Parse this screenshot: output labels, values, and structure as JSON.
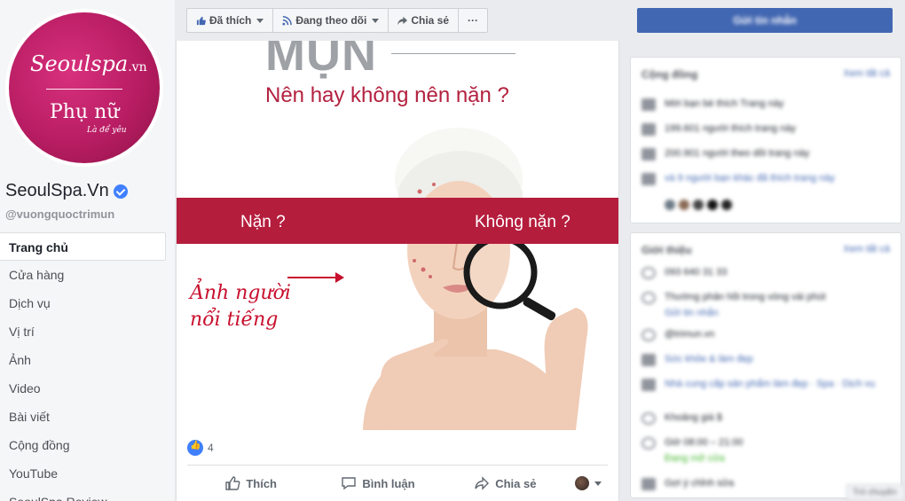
{
  "page": {
    "name": "SeoulSpa.Vn",
    "handle": "@vuongquoctrimun",
    "logo": {
      "top": "Seoulspa",
      "top_suffix": ".vn",
      "bottom": "Phụ nữ",
      "sub": "Là để yêu"
    }
  },
  "nav": {
    "items": [
      {
        "label": "Trang chủ",
        "active": true
      },
      {
        "label": "Cửa hàng"
      },
      {
        "label": "Dịch vụ"
      },
      {
        "label": "Vị trí"
      },
      {
        "label": "Ảnh"
      },
      {
        "label": "Video"
      },
      {
        "label": "Bài viết"
      },
      {
        "label": "Cộng đồng"
      },
      {
        "label": "YouTube"
      },
      {
        "label": "SeoulSpa Review"
      }
    ]
  },
  "action_bar": {
    "liked": "Đã thích",
    "following": "Đang theo dõi",
    "share": "Chia sẻ",
    "more": "···"
  },
  "post": {
    "image": {
      "big_word": "MỤN",
      "headline": "Nên hay không nên nặn ?",
      "left_choice": "Nặn ?",
      "right_choice": "Không nặn ?",
      "caption_line1": "Ảnh người",
      "caption_line2": "nổi tiếng"
    },
    "reaction_count": "4",
    "actions": {
      "like": "Thích",
      "comment": "Bình luận",
      "share": "Chia sẻ"
    }
  },
  "sidebar": {
    "contact_button": "Gửi tin nhắn",
    "community": {
      "title": "Cộng đồng",
      "link": "Xem tất cả",
      "rows": [
        "Mời bạn bè thích Trang này",
        "199.601 người thích trang này",
        "200.901 người theo dõi trang này",
        "và 9 người bạn khác đã thích trang này"
      ]
    },
    "about": {
      "title": "Giới thiệu",
      "link": "Xem tất cả",
      "rows": [
        "093 640 31 33",
        "Thường phản hồi trong vòng vài phút",
        "Gửi tin nhắn",
        "@trimun.vn",
        "Sức khỏe & làm đẹp",
        "Nhà cung cấp sản phẩm làm đẹp · Spa · Dịch vụ",
        "Khoảng giá $",
        "Giờ 08:00 – 21:00",
        "Đang mở cửa",
        "Gợi ý chỉnh sửa"
      ]
    },
    "tooltip": "Trò chuyện"
  },
  "colors": {
    "brand": "#4267b2",
    "page_accent": "#b81d63",
    "banner_red": "#b51d3d"
  }
}
